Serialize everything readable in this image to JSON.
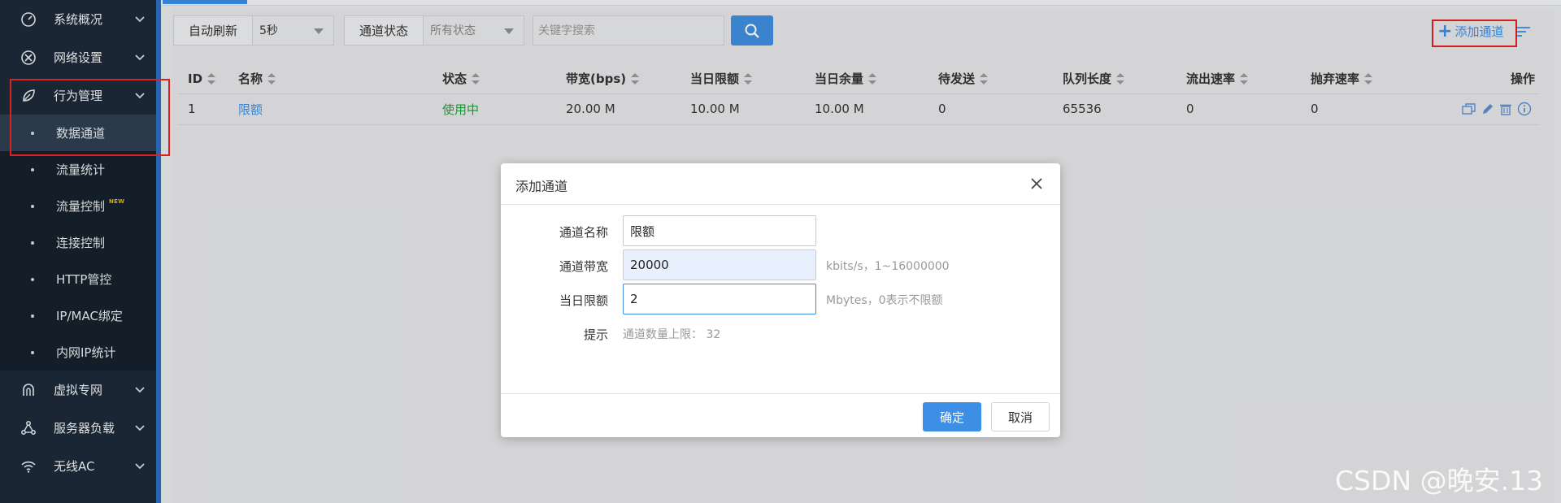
{
  "sidebar": {
    "groups_top": [
      {
        "label": "系统概况",
        "icon": "speedometer-icon"
      },
      {
        "label": "网络设置",
        "icon": "network-cross-icon"
      },
      {
        "label": "行为管理",
        "icon": "behavior-leaf-icon"
      }
    ],
    "sub_items": [
      {
        "label": "数据通道",
        "active": true
      },
      {
        "label": "流量统计"
      },
      {
        "label": "流量控制",
        "badge": "NEW"
      },
      {
        "label": "连接控制"
      },
      {
        "label": "HTTP管控"
      },
      {
        "label": "IP/MAC绑定"
      },
      {
        "label": "内网IP统计"
      }
    ],
    "groups_bottom": [
      {
        "label": "虚拟专网",
        "icon": "vpn-arch-icon"
      },
      {
        "label": "服务器负载",
        "icon": "load-balancer-icon"
      },
      {
        "label": "无线AC",
        "icon": "wifi-icon"
      }
    ]
  },
  "toolbar": {
    "auto_refresh_label": "自动刷新",
    "auto_refresh_value": "5秒",
    "status_label": "通道状态",
    "status_value": "所有状态",
    "search_placeholder": "关键字搜索",
    "add_channel_label": "添加通道"
  },
  "table": {
    "columns": [
      "ID",
      "名称",
      "状态",
      "带宽(bps)",
      "当日限额",
      "当日余量",
      "待发送",
      "队列长度",
      "流出速率",
      "抛弃速率",
      "操作"
    ],
    "rows": [
      {
        "id": "1",
        "name": "限额",
        "status": "使用中",
        "bandwidth": "20.00 M",
        "daily_limit": "10.00 M",
        "daily_remaining": "10.00 M",
        "pending": "0",
        "queue_length": "65536",
        "out_rate": "0",
        "drop_rate": "0"
      }
    ]
  },
  "modal": {
    "title": "添加通道",
    "fields": {
      "name": {
        "label": "通道名称",
        "value": "限额"
      },
      "bandwidth": {
        "label": "通道带宽",
        "value": "20000",
        "hint": "kbits/s，1~16000000"
      },
      "daily_limit": {
        "label": "当日限额",
        "value": "2",
        "hint": "Mbytes，0表示不限额"
      },
      "tip": {
        "label": "提示",
        "text": "通道数量上限： 32"
      }
    },
    "ok_label": "确定",
    "cancel_label": "取消"
  },
  "watermark": "CSDN @晚安.13",
  "colors": {
    "sidebar_bg": "#1d2a38",
    "accent_blue": "#3d8fe6",
    "status_green": "#1aa53a",
    "highlight_red": "#e02020"
  }
}
